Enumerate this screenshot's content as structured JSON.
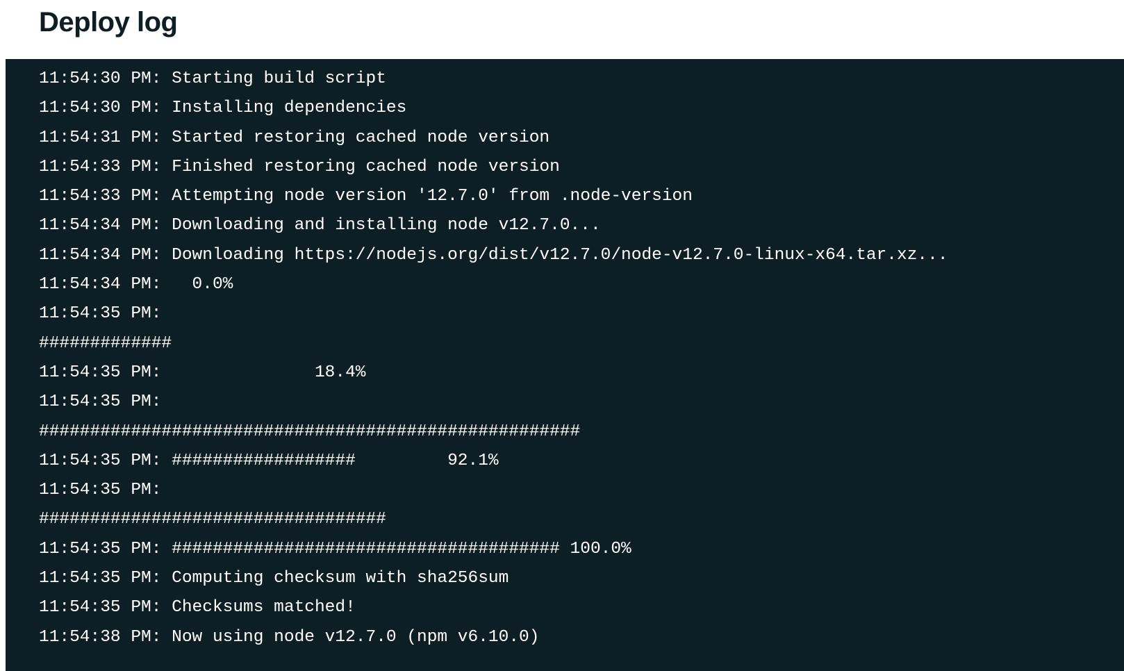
{
  "header": {
    "title": "Deploy log"
  },
  "log": {
    "lines": [
      {
        "ts": "11:54:30 PM:",
        "msg": " Starting build script"
      },
      {
        "ts": "11:54:30 PM:",
        "msg": " Installing dependencies"
      },
      {
        "ts": "11:54:31 PM:",
        "msg": " Started restoring cached node version"
      },
      {
        "ts": "11:54:33 PM:",
        "msg": " Finished restoring cached node version"
      },
      {
        "ts": "11:54:33 PM:",
        "msg": " Attempting node version '12.7.0' from .node-version"
      },
      {
        "ts": "11:54:34 PM:",
        "msg": " Downloading and installing node v12.7.0..."
      },
      {
        "ts": "11:54:34 PM:",
        "msg": " Downloading https://nodejs.org/dist/v12.7.0/node-v12.7.0-linux-x64.tar.xz..."
      },
      {
        "ts": "11:54:34 PM:",
        "msg": "   0.0%"
      },
      {
        "ts": "11:54:35 PM:",
        "msg": " "
      },
      {
        "ts": "",
        "msg": "#############"
      },
      {
        "ts": "11:54:35 PM:",
        "msg": "               18.4%"
      },
      {
        "ts": "11:54:35 PM:",
        "msg": " "
      },
      {
        "ts": "",
        "msg": "#####################################################"
      },
      {
        "ts": "11:54:35 PM:",
        "msg": " ##################         92.1%"
      },
      {
        "ts": "11:54:35 PM:",
        "msg": " "
      },
      {
        "ts": "",
        "msg": "##################################"
      },
      {
        "ts": "11:54:35 PM:",
        "msg": " ###################################### 100.0%"
      },
      {
        "ts": "11:54:35 PM:",
        "msg": " Computing checksum with sha256sum"
      },
      {
        "ts": "11:54:35 PM:",
        "msg": " Checksums matched!"
      },
      {
        "ts": "11:54:38 PM:",
        "msg": " Now using node v12.7.0 (npm v6.10.0)"
      }
    ]
  }
}
